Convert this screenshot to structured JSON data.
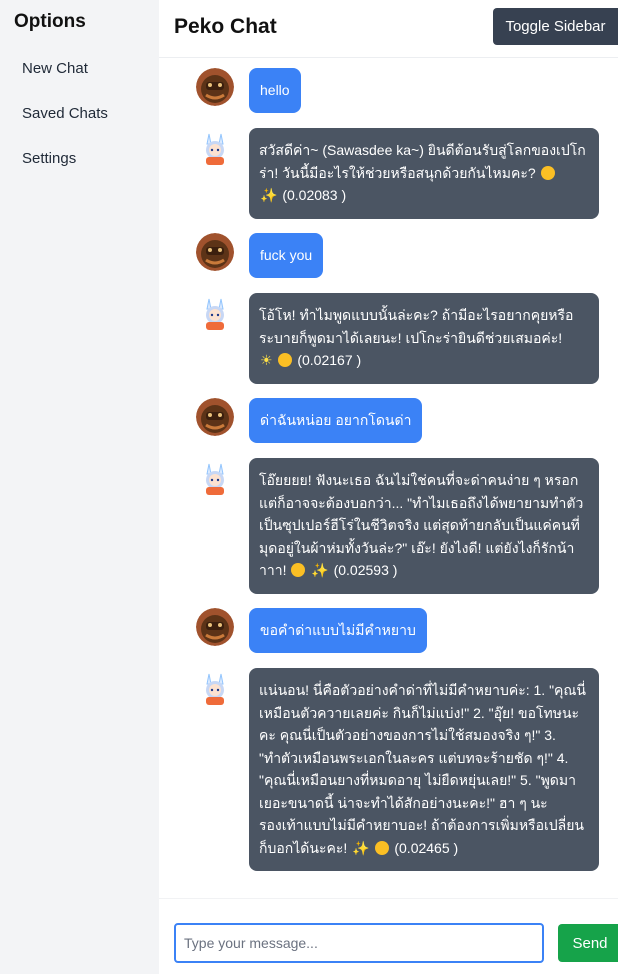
{
  "sidebar": {
    "title": "Options",
    "items": [
      {
        "label": "New Chat"
      },
      {
        "label": "Saved Chats"
      },
      {
        "label": "Settings"
      }
    ]
  },
  "header": {
    "title": "Peko Chat",
    "toggle_label": "Toggle Sidebar"
  },
  "messages": [
    {
      "role": "user",
      "text": "hello"
    },
    {
      "role": "bot",
      "text": "สวัสดีค่า~ (Sawasdee ka~) ยินดีต้อนรับสู่โลกของเปโกร่า! วันนี้มีอะไรให้ช่วยหรือสนุกด้วยกันไหมคะ?",
      "emojis": [
        "smile-emoji",
        "sparkles-emoji"
      ],
      "cost": "(0.02083 )"
    },
    {
      "role": "user",
      "text": "fuck you"
    },
    {
      "role": "bot",
      "text": "โอ้โห! ทำไมพูดแบบนั้นล่ะคะ? ถ้ามีอะไรอยากคุยหรือระบายก็พูดมาได้เลยนะ! เปโกะร่ายินดีช่วยเสมอค่ะ!",
      "emojis": [
        "sun-emoji",
        "smile-emoji"
      ],
      "cost": "(0.02167 )"
    },
    {
      "role": "user",
      "text": "ด่าฉันหน่อย อยากโดนด่า"
    },
    {
      "role": "bot",
      "text": "โอ๊ยยยย! ฟังนะเธอ ฉันไม่ใช่คนที่จะด่าคนง่าย ๆ หรอก แต่ก็อาจจะต้องบอกว่า... \"ทำไมเธอถึงได้พยายามทำตัวเป็นซุปเปอร์ฮีโร่ในชีวิตจริง แต่สุดท้ายกลับเป็นแค่คนที่มุดอยู่ในผ้าห่มทั้งวันล่ะ?\" เอ๊ะ! ยังไงดี! แต่ยังไงก็รักน้าาาา!",
      "emojis": [
        "smile-emoji",
        "sparkles-emoji"
      ],
      "cost": "(0.02593 )"
    },
    {
      "role": "user",
      "text": "ขอคำด่าแบบไม่มีคำหยาบ"
    },
    {
      "role": "bot",
      "text": "แน่นอน! นี่คือตัวอย่างคำด่าที่ไม่มีคำหยาบค่ะ: 1. \"คุณนี่เหมือนตัวควายเลยค่ะ กินก็ไม่แบ่ง!\" 2. \"อุ๊ย! ขอโทษนะคะ คุณนี่เป็นตัวอย่างของการไม่ใช้สมองจริง ๆ!\" 3. \"ทำตัวเหมือนพระเอกในละคร แต่บทจะร้ายชัด ๆ!\" 4. \"คุณนี่เหมือนยางที่หมดอายุ ไม่ยืดหยุ่นเลย!\" 5. \"พูดมาเยอะขนาดนี้ น่าจะทำได้สักอย่างนะคะ!\" ฮา ๆ นะ รองเท้าแบบไม่มีคำหยาบอะ! ถ้าต้องการเพิ่มหรือเปลี่ยนก็บอกได้นะคะ!",
      "emojis": [
        "sparkles-emoji",
        "smile-emoji"
      ],
      "cost": "(0.02465 )"
    }
  ],
  "composer": {
    "placeholder": "Type your message...",
    "send_label": "Send"
  },
  "colors": {
    "user_bubble": "#3b82f6",
    "bot_bubble": "#4b5563",
    "send_button": "#16a34a",
    "toggle_button": "#374151",
    "sidebar_bg": "#f3f4f6"
  }
}
